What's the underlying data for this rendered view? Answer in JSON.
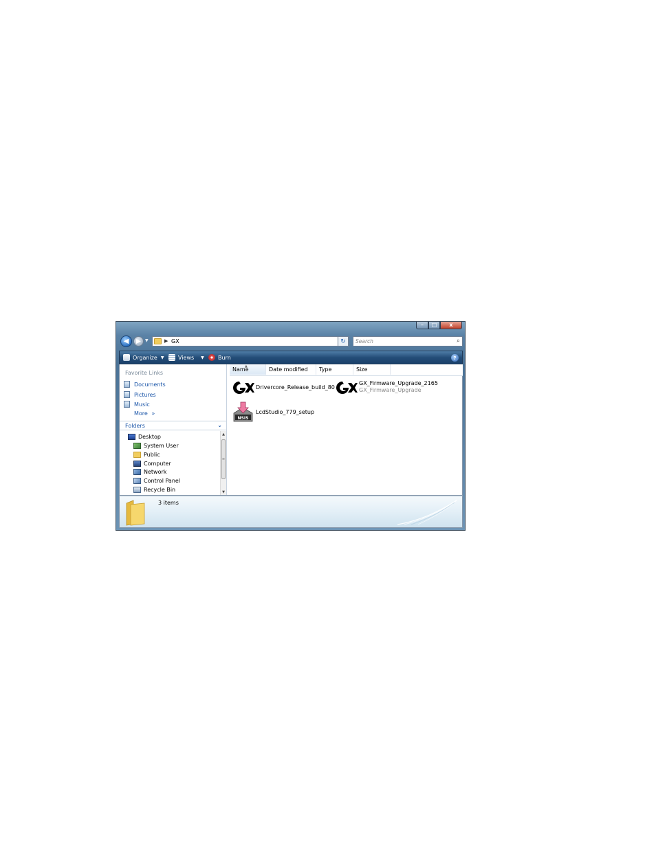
{
  "window": {
    "buttons": {
      "minimize": "–",
      "maximize": "□",
      "close": "x"
    }
  },
  "address": {
    "path": "GX",
    "search_placeholder": "Search"
  },
  "commands": {
    "organize": "Organize",
    "views": "Views",
    "burn": "Burn"
  },
  "nav": {
    "favorite_links_title": "Favorite Links",
    "favorites": [
      {
        "label": "Documents",
        "icon": "documents-icon"
      },
      {
        "label": "Pictures",
        "icon": "pictures-icon"
      },
      {
        "label": "Music",
        "icon": "music-icon"
      }
    ],
    "more": "More",
    "more_arrows": "»",
    "folders_title": "Folders",
    "tree": [
      {
        "label": "Desktop",
        "icon": "desktop-icon"
      },
      {
        "label": "System User",
        "icon": "user-folder-icon"
      },
      {
        "label": "Public",
        "icon": "folder-icon"
      },
      {
        "label": "Computer",
        "icon": "computer-icon"
      },
      {
        "label": "Network",
        "icon": "network-icon"
      },
      {
        "label": "Control Panel",
        "icon": "control-panel-icon"
      },
      {
        "label": "Recycle Bin",
        "icon": "recycle-bin-icon"
      }
    ]
  },
  "columns": [
    "Name",
    "Date modified",
    "Type",
    "Size"
  ],
  "files": [
    {
      "name": "Drivercore_Release_build_80",
      "icon": "gx-logo-icon"
    },
    {
      "name": "GX_Firmware_Upgrade_2165",
      "subtitle": "GX_Firmware_Upgrade",
      "icon": "gx-logo-icon"
    },
    {
      "name": "LcdStudio_779_setup",
      "icon": "installer-icon"
    }
  ],
  "status": {
    "item_count": "3 items"
  },
  "colors": {
    "link_blue": "#1a55a8",
    "cmdbar_dark": "#1b416b",
    "folder_yellow": "#f1cd5e"
  }
}
